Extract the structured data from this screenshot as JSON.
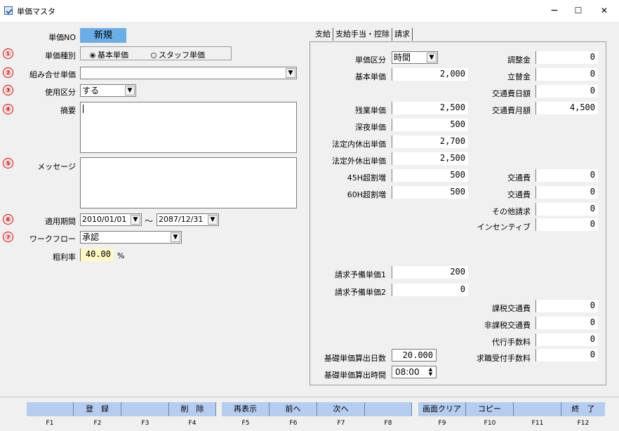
{
  "window": {
    "title": "単価マスタ",
    "min": "−",
    "max": "☐",
    "close": "✕"
  },
  "left": {
    "tanka_no_label": "単価NO",
    "tanka_no_value": "新規",
    "type_label": "単価種別",
    "radio_basic": "基本単価",
    "radio_staff": "スタッフ単価",
    "combo_label": "組み合せ単価",
    "combo_value": "",
    "use_label": "使用区分",
    "use_value": "する",
    "summary_label": "摘要",
    "message_label": "メッセージ",
    "period_label": "適用期間",
    "period_from": "2010/01/01",
    "period_tilde": "～",
    "period_to": "2087/12/31",
    "workflow_label": "ワークフロー",
    "workflow_value": "承認",
    "margin_label": "粗利率",
    "margin_value": "40.00",
    "margin_unit": "%",
    "markers": [
      "①",
      "②",
      "③",
      "④",
      "⑤",
      "⑥",
      "⑦"
    ]
  },
  "tabs": [
    "支給",
    "支給手当・控除",
    "請求"
  ],
  "right": {
    "kubun_label": "単価区分",
    "kubun_value": "時間",
    "kihon_label": "基本単価",
    "kihon_value": "2,000",
    "zangyo_label": "残業単価",
    "zangyo_value": "2,500",
    "shinya_label": "深夜単価",
    "shinya_value": "500",
    "hoteinai_label": "法定内休出単価",
    "hoteinai_value": "2,700",
    "hoteigai_label": "法定外休出単価",
    "hoteigai_value": "2,500",
    "h45_label": "45H超割増",
    "h45_value": "500",
    "h60_label": "60H超割増",
    "h60_value": "500",
    "yobi1_label": "請求予備単価1",
    "yobi1_value": "200",
    "yobi2_label": "請求予備単価2",
    "yobi2_value": "0",
    "days_label": "基礎単価算出日数",
    "days_value": "20.000",
    "hours_label": "基礎単価算出時間",
    "hours_value": "08:00",
    "chosei_label": "調整金",
    "chosei_value": "0",
    "tatekae_label": "立替金",
    "tatekae_value": "0",
    "koutsu_day_label": "交通費日額",
    "koutsu_day_value": "0",
    "koutsu_month_label": "交通費月額",
    "koutsu_month_value": "4,500",
    "koutsu1_label": "交通費",
    "koutsu1_value": "0",
    "koutsu2_label": "交通費",
    "koutsu2_value": "0",
    "other_label": "その他請求",
    "other_value": "0",
    "incentive_label": "インセンティブ",
    "incentive_value": "0",
    "kazei_label": "課税交通費",
    "kazei_value": "0",
    "hikazei_label": "非課税交通費",
    "hikazei_value": "0",
    "daiko_label": "代行手数料",
    "daiko_value": "0",
    "kyushoku_label": "求職受付手数料",
    "kyushoku_value": "0"
  },
  "fkeys": [
    {
      "label": "",
      "key": "F1"
    },
    {
      "label": "登　録",
      "key": "F2"
    },
    {
      "label": "",
      "key": "F3"
    },
    {
      "label": "削　除",
      "key": "F4"
    },
    {
      "label": "再表示",
      "key": "F5"
    },
    {
      "label": "前へ",
      "key": "F6"
    },
    {
      "label": "次へ",
      "key": "F7"
    },
    {
      "label": "",
      "key": "F8"
    },
    {
      "label": "画面クリア",
      "key": "F9"
    },
    {
      "label": "コピー",
      "key": "F10"
    },
    {
      "label": "",
      "key": "F11"
    },
    {
      "label": "終　了",
      "key": "F12"
    }
  ]
}
